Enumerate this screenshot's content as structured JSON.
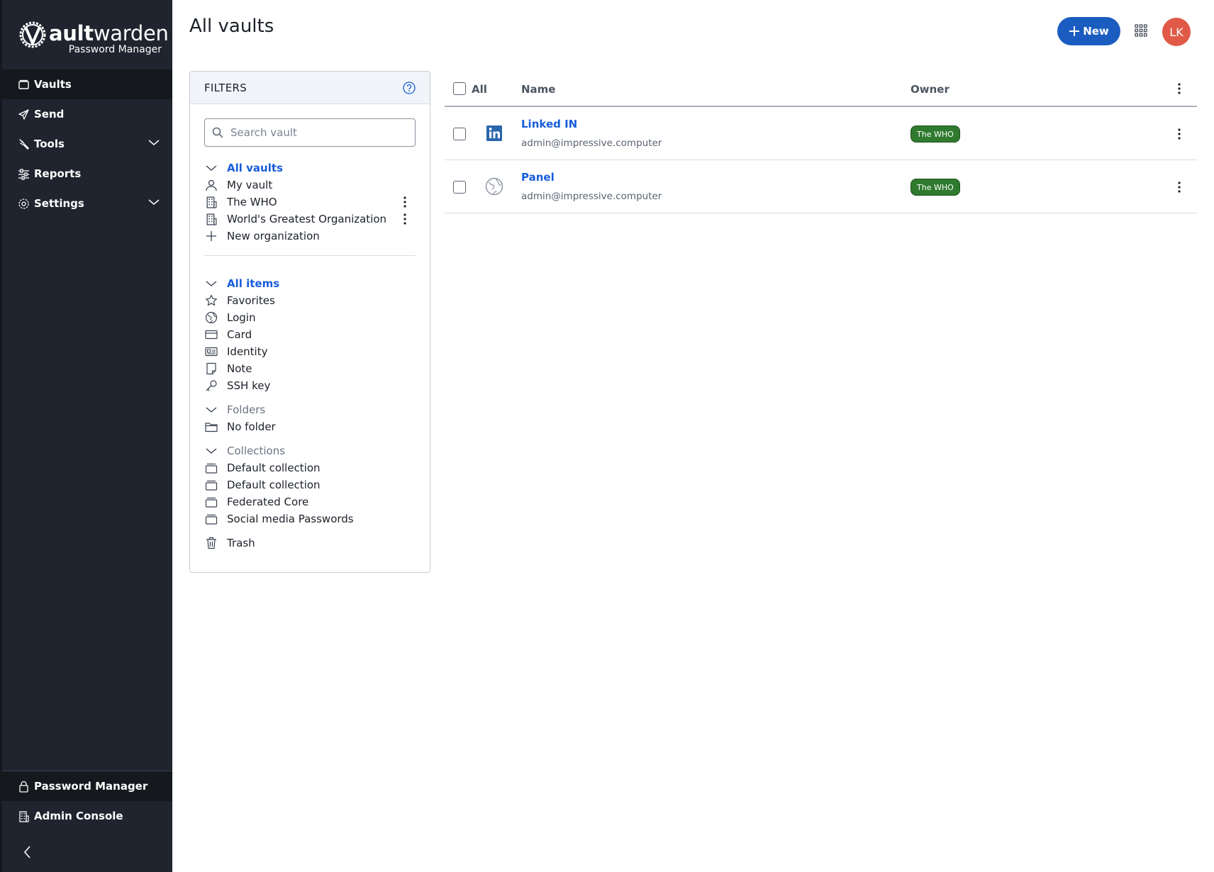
{
  "brand": {
    "word_regular": "V",
    "word_bold": "ault",
    "word_rest": "warden",
    "subtitle": "Password Manager"
  },
  "sidebar": {
    "items": [
      {
        "label": "Vaults",
        "icon": "vault-icon",
        "active": true
      },
      {
        "label": "Send",
        "icon": "send-icon"
      },
      {
        "label": "Tools",
        "icon": "wrench-icon",
        "expandable": true
      },
      {
        "label": "Reports",
        "icon": "sliders-icon"
      },
      {
        "label": "Settings",
        "icon": "gear-icon",
        "expandable": true
      }
    ],
    "bottom": [
      {
        "label": "Password Manager",
        "icon": "lock-icon",
        "active": true
      },
      {
        "label": "Admin Console",
        "icon": "building-icon"
      }
    ]
  },
  "header": {
    "title": "All vaults",
    "new_label": "New",
    "avatar_initials": "LK"
  },
  "filters": {
    "title": "FILTERS",
    "search_placeholder": "Search vault",
    "vaults_header": "All vaults",
    "vaults": [
      "My vault",
      "The WHO",
      "World's Greatest Organization",
      "New organization"
    ],
    "items_header": "All items",
    "types": [
      "Favorites",
      "Login",
      "Card",
      "Identity",
      "Note",
      "SSH key"
    ],
    "folders_header": "Folders",
    "folders": [
      "No folder"
    ],
    "collections_header": "Collections",
    "collections": [
      "Default collection",
      "Default collection",
      "Federated Core",
      "Social media Passwords"
    ],
    "trash": "Trash"
  },
  "table": {
    "col_all": "All",
    "col_name": "Name",
    "col_owner": "Owner",
    "rows": [
      {
        "name": "Linked IN",
        "username": "admin@impressive.computer",
        "owner": "The WHO",
        "icon": "linkedin-icon"
      },
      {
        "name": "Panel",
        "username": "admin@impressive.computer",
        "owner": "The WHO",
        "icon": "globe-icon"
      }
    ]
  },
  "colors": {
    "sidebar_bg": "#1f242e",
    "accent": "#175ddc",
    "owner_badge": "#2f7a2f",
    "avatar": "#e05a47"
  }
}
